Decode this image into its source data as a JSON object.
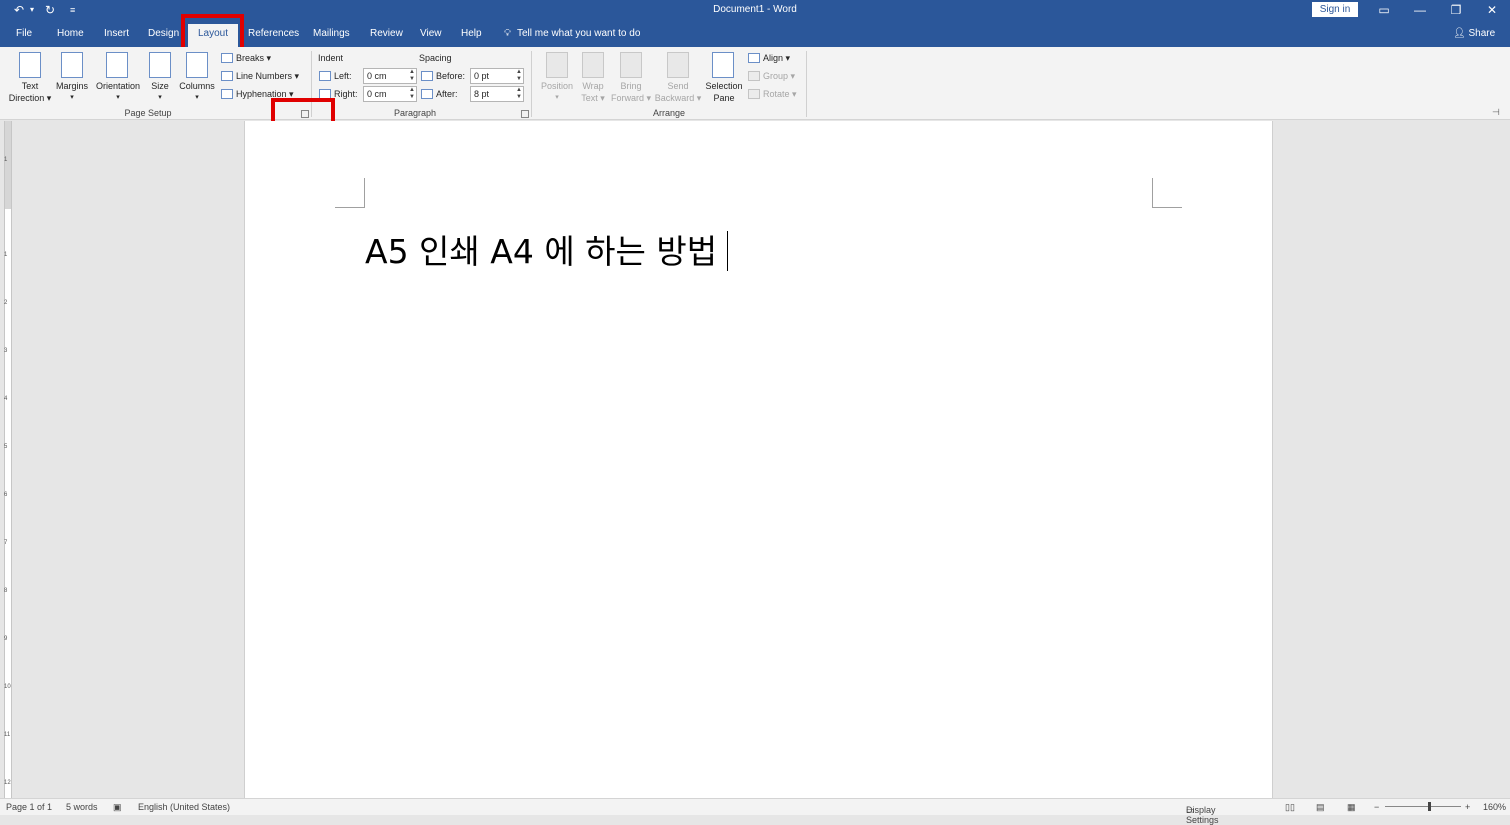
{
  "titlebar": {
    "title": "Document1 - Word",
    "undo_icon": "undo-icon",
    "redo_icon": "redo-icon",
    "qat_icon": "customize-qat-icon",
    "sign_in": "Sign in",
    "ribbon_display_icon": "ribbon-display-options-icon",
    "minimize_icon": "minimize-icon",
    "restore_icon": "restore-icon",
    "close_icon": "close-icon"
  },
  "tabs": [
    {
      "label": "File"
    },
    {
      "label": "Home"
    },
    {
      "label": "Insert"
    },
    {
      "label": "Design"
    },
    {
      "label": "Layout",
      "active": true
    },
    {
      "label": "References"
    },
    {
      "label": "Mailings"
    },
    {
      "label": "Review"
    },
    {
      "label": "View"
    },
    {
      "label": "Help"
    }
  ],
  "tell_me": "Tell me what you want to do",
  "share": "Share",
  "ribbon": {
    "page_setup": {
      "label": "Page Setup",
      "text_direction": [
        "Text",
        "Direction"
      ],
      "margins": "Margins",
      "orientation": "Orientation",
      "size": "Size",
      "columns": "Columns",
      "breaks": "Breaks",
      "line_numbers": "Line Numbers",
      "hyphenation": "Hyphenation"
    },
    "paragraph": {
      "label": "Paragraph",
      "indent": "Indent",
      "spacing": "Spacing",
      "left_label": "Left:",
      "left_value": "0 cm",
      "right_label": "Right:",
      "right_value": "0 cm",
      "before_label": "Before:",
      "before_value": "0 pt",
      "after_label": "After:",
      "after_value": "8 pt"
    },
    "arrange": {
      "label": "Arrange",
      "position": "Position",
      "wrap_text": [
        "Wrap",
        "Text"
      ],
      "bring_forward": [
        "Bring",
        "Forward"
      ],
      "send_backward": [
        "Send",
        "Backward"
      ],
      "selection_pane": [
        "Selection",
        "Pane"
      ],
      "align": "Align",
      "group": "Group",
      "rotate": "Rotate"
    }
  },
  "document": {
    "text": "A5 인쇄 A4 에 하는 방법"
  },
  "ruler_numbers": [
    "1",
    "1",
    "2",
    "3",
    "4",
    "5",
    "6",
    "7",
    "8",
    "9",
    "10",
    "11",
    "12"
  ],
  "statusbar": {
    "page": "Page 1 of 1",
    "words": "5 words",
    "language": "English (United States)",
    "display_settings": "Display Settings",
    "zoom": "160%"
  },
  "colors": {
    "brand": "#2b579a",
    "highlight": "#e00000"
  }
}
